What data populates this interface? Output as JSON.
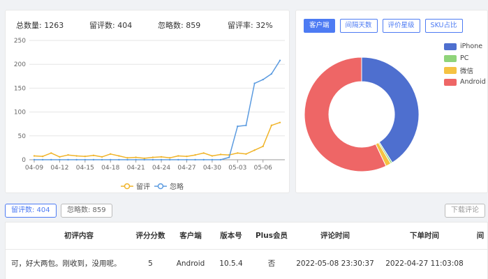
{
  "stats": {
    "total_label": "总数量:",
    "total_value": "1263",
    "reviews_label": "留评数:",
    "reviews_value": "404",
    "ignored_label": "忽略数:",
    "ignored_value": "859",
    "rate_label": "留评率:",
    "rate_value": "32%"
  },
  "line_chart": {
    "legend": {
      "reviews": "留评",
      "ignored": "忽略"
    },
    "colors": {
      "reviews": "#f0b429",
      "ignored": "#5b9be0"
    }
  },
  "tabs": [
    "客户端",
    "间隔天数",
    "评价星级",
    "SKU占比"
  ],
  "pie_legend": [
    {
      "label": "iPhone",
      "color": "#4e6fcf"
    },
    {
      "label": "PC",
      "color": "#8fd47a"
    },
    {
      "label": "微信",
      "color": "#f5c242"
    },
    {
      "label": "Android",
      "color": "#ee6666"
    }
  ],
  "buttons": {
    "reviews": "留评数: 404",
    "ignored": "忽略数: 859",
    "download": "下载评论"
  },
  "table": {
    "headers": [
      "初评内容",
      "评分分数",
      "客户端",
      "版本号",
      "Plus会员",
      "评论时间",
      "下单时间",
      "间"
    ],
    "rows": [
      [
        "可，好大两包。刚收到，没用呢。",
        "5",
        "Android",
        "10.5.4",
        "否",
        "2022-05-08 23:30:37",
        "2022-04-27 11:03:08",
        ""
      ]
    ]
  },
  "chart_data": [
    {
      "type": "line",
      "x": [
        "04-09",
        "04-10",
        "04-11",
        "04-12",
        "04-13",
        "04-14",
        "04-15",
        "04-16",
        "04-17",
        "04-18",
        "04-19",
        "04-20",
        "04-21",
        "04-22",
        "04-23",
        "04-24",
        "04-25",
        "04-26",
        "04-27",
        "04-28",
        "04-29",
        "04-30",
        "05-01",
        "05-02",
        "05-03",
        "05-04",
        "05-05",
        "05-06",
        "05-07",
        "05-08"
      ],
      "xticks": [
        "04-09",
        "04-12",
        "04-15",
        "04-18",
        "04-21",
        "04-24",
        "04-27",
        "04-30",
        "05-03",
        "05-06"
      ],
      "yticks": [
        0,
        50,
        100,
        150,
        200,
        250
      ],
      "ylim": [
        0,
        250
      ],
      "grid": true,
      "legend_position": "bottom",
      "series": [
        {
          "name": "留评",
          "values": [
            8,
            7,
            14,
            6,
            10,
            8,
            7,
            9,
            6,
            12,
            8,
            4,
            5,
            3,
            5,
            6,
            4,
            8,
            7,
            10,
            14,
            8,
            11,
            10,
            14,
            12,
            20,
            28,
            72,
            78
          ]
        },
        {
          "name": "忽略",
          "values": [
            0,
            0,
            0,
            0,
            0,
            0,
            0,
            0,
            0,
            0,
            0,
            0,
            0,
            0,
            0,
            0,
            0,
            0,
            0,
            0,
            0,
            0,
            0,
            5,
            70,
            72,
            160,
            168,
            180,
            208
          ]
        }
      ]
    },
    {
      "type": "pie",
      "donut": true,
      "labels": [
        "iPhone",
        "PC",
        "微信",
        "Android"
      ],
      "values": [
        41,
        0.5,
        1.5,
        57
      ]
    }
  ]
}
